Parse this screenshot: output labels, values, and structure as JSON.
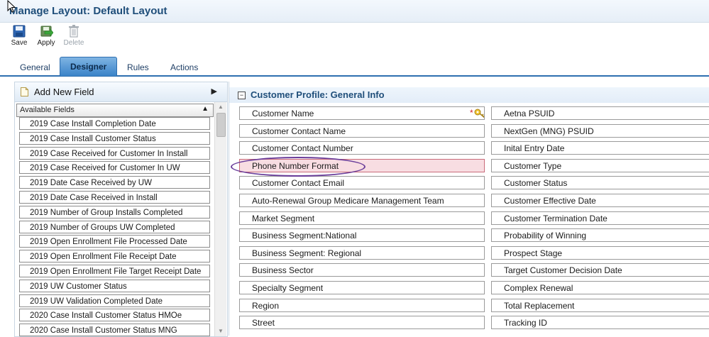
{
  "window": {
    "title": "Manage Layout: Default Layout"
  },
  "toolbar": {
    "save_label": "Save",
    "apply_label": "Apply",
    "delete_label": "Delete"
  },
  "tabs": [
    {
      "label": "General",
      "active": false
    },
    {
      "label": "Designer",
      "active": true
    },
    {
      "label": "Rules",
      "active": false
    },
    {
      "label": "Actions",
      "active": false
    }
  ],
  "left_panel": {
    "add_new_field_label": "Add New Field",
    "available_fields_header": "Available Fields",
    "fields": [
      "2019 Case Install Completion Date",
      "2019 Case Install Customer Status",
      "2019 Case Received for Customer In Install",
      "2019 Case Received for Customer In UW",
      "2019 Date Case Received by UW",
      "2019 Date Case Received in Install",
      "2019 Number of Group Installs Completed",
      "2019 Number of Groups UW Completed",
      "2019 Open Enrollment File Processed Date",
      "2019 Open Enrollment File Receipt Date",
      "2019 Open Enrollment File Target Receipt Date",
      "2019 UW Customer Status",
      "2019 UW Validation Completed Date",
      "2020 Case Install Customer Status HMOe",
      "2020 Case Install Customer Status MNG"
    ]
  },
  "section": {
    "title": "Customer Profile:  General Info",
    "left_column": [
      "Customer Name",
      "Customer Contact Name",
      "Customer Contact Number",
      "Phone Number Format",
      "Customer Contact Email",
      "Auto-Renewal Group Medicare Management Team",
      "Market Segment",
      "Business Segment:National",
      "Business Segment: Regional",
      "Business Sector",
      "Specialty Segment",
      "Region",
      "Street"
    ],
    "right_column": [
      "Aetna PSUID",
      "NextGen (MNG) PSUID",
      "Inital Entry Date",
      "Customer Type",
      "Customer Status",
      "Customer Effective Date",
      "Customer Termination Date",
      "Probability of Winning",
      "Prospect Stage",
      "Target Customer Decision Date",
      "Complex Renewal",
      "Total Replacement",
      "Tracking ID"
    ],
    "required_marker": "*",
    "highlighted_field": "Phone Number Format"
  },
  "colors": {
    "title": "#1f4e7a",
    "active_tab": "#3a83c8",
    "highlight_fill": "#f8dde2",
    "annotation_ellipse": "#6a3d9a"
  }
}
